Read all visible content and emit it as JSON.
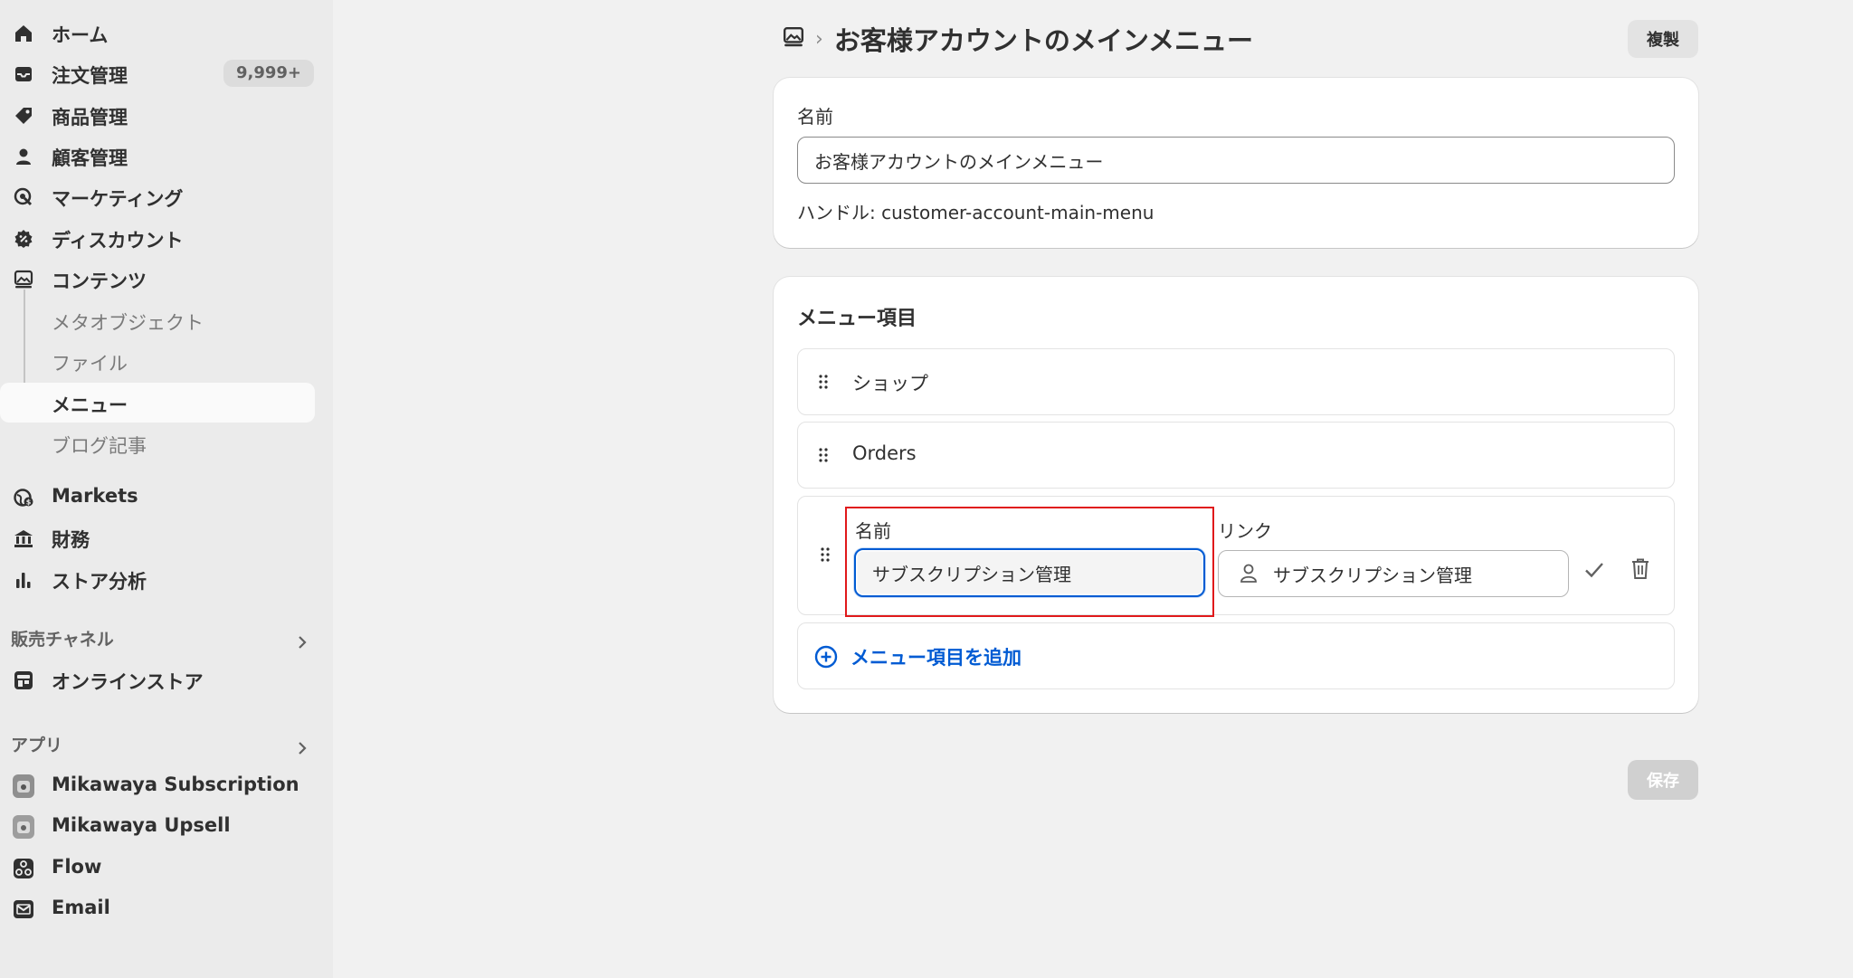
{
  "sidebar": {
    "nav": [
      {
        "label": "ホーム",
        "icon": "home-icon"
      },
      {
        "label": "注文管理",
        "icon": "inbox-icon",
        "badge": "9,999+"
      },
      {
        "label": "商品管理",
        "icon": "tag-icon"
      },
      {
        "label": "顧客管理",
        "icon": "person-icon"
      },
      {
        "label": "マーケティング",
        "icon": "target-icon"
      },
      {
        "label": "ディスカウント",
        "icon": "discount-icon"
      },
      {
        "label": "コンテンツ",
        "icon": "image-icon"
      }
    ],
    "content_sub": [
      {
        "label": "メタオブジェクト"
      },
      {
        "label": "ファイル"
      },
      {
        "label": "メニュー",
        "active": true
      },
      {
        "label": "ブログ記事"
      }
    ],
    "nav2": [
      {
        "label": "Markets",
        "icon": "globe-icon"
      },
      {
        "label": "財務",
        "icon": "bank-icon"
      },
      {
        "label": "ストア分析",
        "icon": "bar-chart-icon"
      }
    ],
    "sales_channels": {
      "heading": "販売チャネル",
      "items": [
        {
          "label": "オンラインストア",
          "icon": "store-icon"
        }
      ]
    },
    "apps": {
      "heading": "アプリ",
      "items": [
        {
          "label": "Mikawaya Subscription",
          "icon": "app-icon"
        },
        {
          "label": "Mikawaya Upsell",
          "icon": "app-icon"
        },
        {
          "label": "Flow",
          "icon": "flow-icon"
        },
        {
          "label": "Email",
          "icon": "email-icon"
        }
      ]
    }
  },
  "header": {
    "breadcrumb_icon": "image-icon",
    "breadcrumb_sep": "›",
    "title": "お客様アカウントのメインメニュー",
    "duplicate_label": "複製"
  },
  "name_card": {
    "label": "名前",
    "value": "お客様アカウントのメインメニュー",
    "handle": "ハンドル: customer-account-main-menu"
  },
  "menu_card": {
    "title": "メニュー項目",
    "items": [
      {
        "label": "ショップ"
      },
      {
        "label": "Orders"
      }
    ],
    "editing": {
      "name_label": "名前",
      "name_value": "サブスクリプション管理",
      "link_label": "リンク",
      "link_value": "サブスクリプション管理"
    },
    "add_label": "メニュー項目を追加"
  },
  "footer": {
    "save_label": "保存"
  },
  "colors": {
    "accent": "#005bd3",
    "highlight": "#e0191b",
    "sidebar_bg": "#ebebeb",
    "page_bg": "#f1f1f1"
  }
}
